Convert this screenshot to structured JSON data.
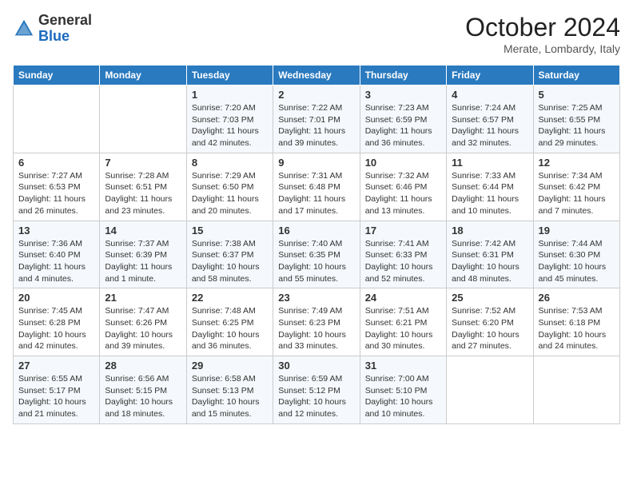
{
  "header": {
    "logo_general": "General",
    "logo_blue": "Blue",
    "month": "October 2024",
    "location": "Merate, Lombardy, Italy"
  },
  "columns": [
    "Sunday",
    "Monday",
    "Tuesday",
    "Wednesday",
    "Thursday",
    "Friday",
    "Saturday"
  ],
  "weeks": [
    [
      {
        "day": "",
        "info": ""
      },
      {
        "day": "",
        "info": ""
      },
      {
        "day": "1",
        "info": "Sunrise: 7:20 AM\nSunset: 7:03 PM\nDaylight: 11 hours and 42 minutes."
      },
      {
        "day": "2",
        "info": "Sunrise: 7:22 AM\nSunset: 7:01 PM\nDaylight: 11 hours and 39 minutes."
      },
      {
        "day": "3",
        "info": "Sunrise: 7:23 AM\nSunset: 6:59 PM\nDaylight: 11 hours and 36 minutes."
      },
      {
        "day": "4",
        "info": "Sunrise: 7:24 AM\nSunset: 6:57 PM\nDaylight: 11 hours and 32 minutes."
      },
      {
        "day": "5",
        "info": "Sunrise: 7:25 AM\nSunset: 6:55 PM\nDaylight: 11 hours and 29 minutes."
      }
    ],
    [
      {
        "day": "6",
        "info": "Sunrise: 7:27 AM\nSunset: 6:53 PM\nDaylight: 11 hours and 26 minutes."
      },
      {
        "day": "7",
        "info": "Sunrise: 7:28 AM\nSunset: 6:51 PM\nDaylight: 11 hours and 23 minutes."
      },
      {
        "day": "8",
        "info": "Sunrise: 7:29 AM\nSunset: 6:50 PM\nDaylight: 11 hours and 20 minutes."
      },
      {
        "day": "9",
        "info": "Sunrise: 7:31 AM\nSunset: 6:48 PM\nDaylight: 11 hours and 17 minutes."
      },
      {
        "day": "10",
        "info": "Sunrise: 7:32 AM\nSunset: 6:46 PM\nDaylight: 11 hours and 13 minutes."
      },
      {
        "day": "11",
        "info": "Sunrise: 7:33 AM\nSunset: 6:44 PM\nDaylight: 11 hours and 10 minutes."
      },
      {
        "day": "12",
        "info": "Sunrise: 7:34 AM\nSunset: 6:42 PM\nDaylight: 11 hours and 7 minutes."
      }
    ],
    [
      {
        "day": "13",
        "info": "Sunrise: 7:36 AM\nSunset: 6:40 PM\nDaylight: 11 hours and 4 minutes."
      },
      {
        "day": "14",
        "info": "Sunrise: 7:37 AM\nSunset: 6:39 PM\nDaylight: 11 hours and 1 minute."
      },
      {
        "day": "15",
        "info": "Sunrise: 7:38 AM\nSunset: 6:37 PM\nDaylight: 10 hours and 58 minutes."
      },
      {
        "day": "16",
        "info": "Sunrise: 7:40 AM\nSunset: 6:35 PM\nDaylight: 10 hours and 55 minutes."
      },
      {
        "day": "17",
        "info": "Sunrise: 7:41 AM\nSunset: 6:33 PM\nDaylight: 10 hours and 52 minutes."
      },
      {
        "day": "18",
        "info": "Sunrise: 7:42 AM\nSunset: 6:31 PM\nDaylight: 10 hours and 48 minutes."
      },
      {
        "day": "19",
        "info": "Sunrise: 7:44 AM\nSunset: 6:30 PM\nDaylight: 10 hours and 45 minutes."
      }
    ],
    [
      {
        "day": "20",
        "info": "Sunrise: 7:45 AM\nSunset: 6:28 PM\nDaylight: 10 hours and 42 minutes."
      },
      {
        "day": "21",
        "info": "Sunrise: 7:47 AM\nSunset: 6:26 PM\nDaylight: 10 hours and 39 minutes."
      },
      {
        "day": "22",
        "info": "Sunrise: 7:48 AM\nSunset: 6:25 PM\nDaylight: 10 hours and 36 minutes."
      },
      {
        "day": "23",
        "info": "Sunrise: 7:49 AM\nSunset: 6:23 PM\nDaylight: 10 hours and 33 minutes."
      },
      {
        "day": "24",
        "info": "Sunrise: 7:51 AM\nSunset: 6:21 PM\nDaylight: 10 hours and 30 minutes."
      },
      {
        "day": "25",
        "info": "Sunrise: 7:52 AM\nSunset: 6:20 PM\nDaylight: 10 hours and 27 minutes."
      },
      {
        "day": "26",
        "info": "Sunrise: 7:53 AM\nSunset: 6:18 PM\nDaylight: 10 hours and 24 minutes."
      }
    ],
    [
      {
        "day": "27",
        "info": "Sunrise: 6:55 AM\nSunset: 5:17 PM\nDaylight: 10 hours and 21 minutes."
      },
      {
        "day": "28",
        "info": "Sunrise: 6:56 AM\nSunset: 5:15 PM\nDaylight: 10 hours and 18 minutes."
      },
      {
        "day": "29",
        "info": "Sunrise: 6:58 AM\nSunset: 5:13 PM\nDaylight: 10 hours and 15 minutes."
      },
      {
        "day": "30",
        "info": "Sunrise: 6:59 AM\nSunset: 5:12 PM\nDaylight: 10 hours and 12 minutes."
      },
      {
        "day": "31",
        "info": "Sunrise: 7:00 AM\nSunset: 5:10 PM\nDaylight: 10 hours and 10 minutes."
      },
      {
        "day": "",
        "info": ""
      },
      {
        "day": "",
        "info": ""
      }
    ]
  ]
}
